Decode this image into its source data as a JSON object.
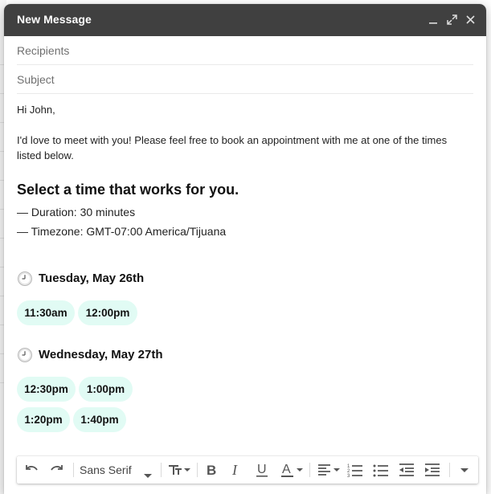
{
  "window": {
    "title": "New Message",
    "controls": [
      "minimize-icon",
      "expand-icon",
      "close-icon"
    ]
  },
  "fields": {
    "recipients_placeholder": "Recipients",
    "subject_placeholder": "Subject"
  },
  "message": {
    "greeting": "Hi John,",
    "intro_line1": "I'd love to meet with you! Please feel free to book an appointment with me at one of the times",
    "intro_line2": "listed below.",
    "heading": "Select a time that works for you.",
    "duration": "— Duration: 30 minutes",
    "timezone": "— Timezone: GMT-07:00 America/Tijuana"
  },
  "days": [
    {
      "label": "Tuesday, May 26th",
      "slots": [
        "11:30am",
        "12:00pm"
      ]
    },
    {
      "label": "Wednesday, May 27th",
      "slots": [
        "12:30pm",
        "1:00pm",
        "1:20pm",
        "1:40pm"
      ]
    }
  ],
  "toolbar": {
    "font_name": "Sans Serif",
    "icons": [
      "undo-icon",
      "redo-icon",
      "font-size-icon",
      "bold-icon",
      "italic-icon",
      "underline-icon",
      "text-color-icon",
      "align-icon",
      "numbered-list-icon",
      "bulleted-list-icon",
      "indent-less-icon",
      "indent-more-icon",
      "more-options-icon"
    ]
  },
  "colors": {
    "titlebar": "#404040",
    "slot_background": "#e1fbf4"
  }
}
